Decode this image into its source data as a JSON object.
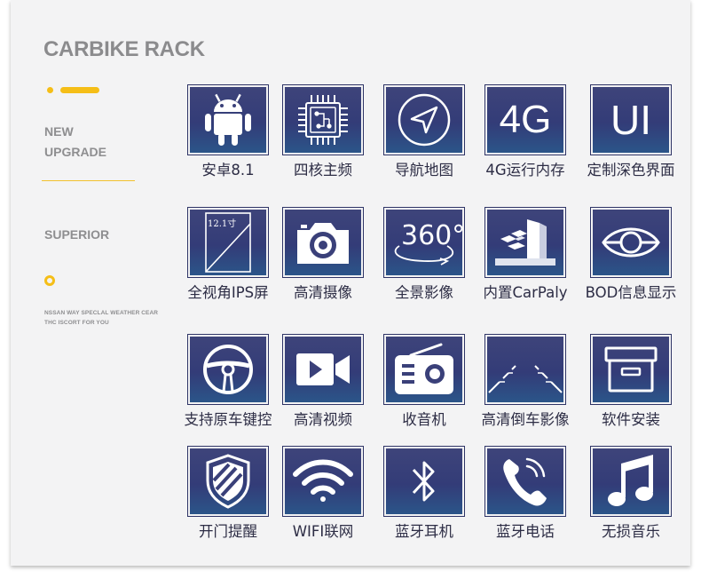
{
  "brand": {
    "title": "CARBIKE RACK",
    "accent_color": "#f5be17"
  },
  "sidebar": {
    "new_line1": "NEW",
    "new_line2": "UPGRADE",
    "superior": "SUPERIOR",
    "fine_line1": "NSSAN WAY SPECLAL WEATHER CEAR",
    "fine_line2": "THC ISCORT FOR YOU"
  },
  "tile_color": "#363d78",
  "features": [
    {
      "label": "安卓8.1",
      "icon": "android-icon"
    },
    {
      "label": "四核主频",
      "icon": "chip-icon"
    },
    {
      "label": "导航地图",
      "icon": "navigation-icon"
    },
    {
      "label": "4G运行内存",
      "icon": "4g-icon",
      "icon_text": "4G"
    },
    {
      "label": "定制深色界面",
      "icon": "ui-icon",
      "icon_text": "UI"
    },
    {
      "label": "全视角IPS屏",
      "icon": "screen-icon",
      "icon_text": "12.1寸"
    },
    {
      "label": "高清摄像",
      "icon": "camera-icon"
    },
    {
      "label": "全景影像",
      "icon": "360-icon",
      "icon_text": "360°"
    },
    {
      "label": "内置CarPaly",
      "icon": "carplay-icon"
    },
    {
      "label": "BOD信息显示",
      "icon": "eye-icon"
    },
    {
      "label": "支持原车键控",
      "icon": "steering-wheel-icon"
    },
    {
      "label": "高清视频",
      "icon": "video-icon"
    },
    {
      "label": "收音机",
      "icon": "radio-icon"
    },
    {
      "label": "高清倒车影像",
      "icon": "reverse-camera-icon"
    },
    {
      "label": "软件安装",
      "icon": "box-icon"
    },
    {
      "label": "开门提醒",
      "icon": "shield-icon"
    },
    {
      "label": "WIFI联网",
      "icon": "wifi-icon"
    },
    {
      "label": "蓝牙耳机",
      "icon": "bluetooth-icon"
    },
    {
      "label": "蓝牙电话",
      "icon": "phone-icon"
    },
    {
      "label": "无损音乐",
      "icon": "music-icon"
    }
  ]
}
